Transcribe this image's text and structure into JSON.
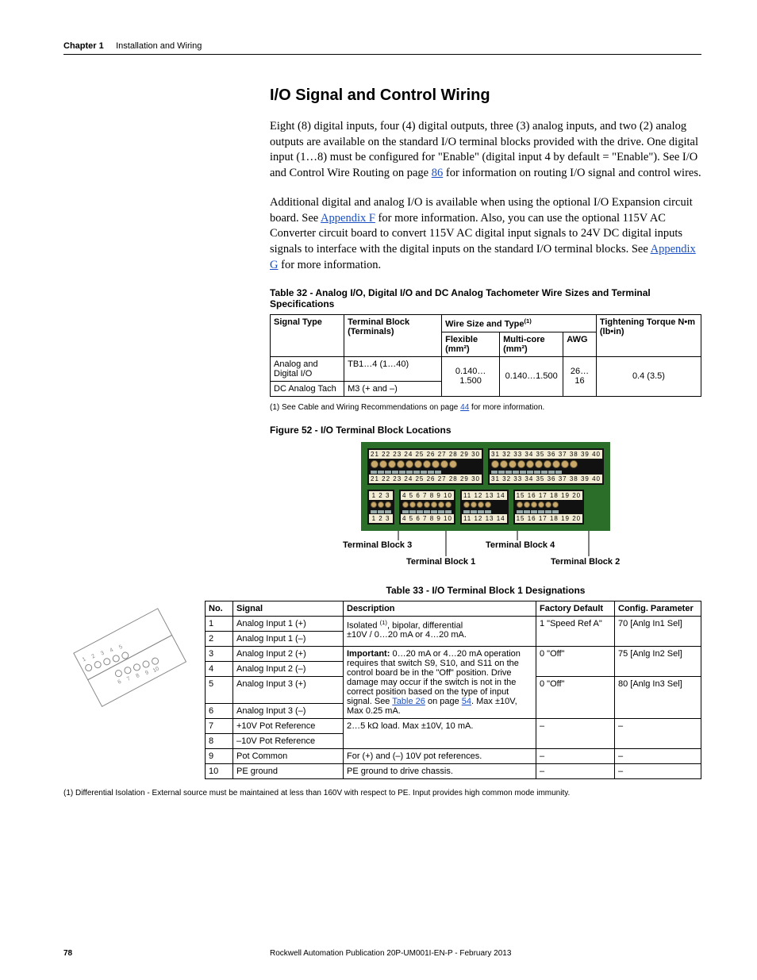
{
  "header": {
    "chapter": "Chapter 1",
    "title": "Installation and Wiring"
  },
  "section": {
    "heading": "I/O Signal and Control Wiring",
    "p1a": "Eight (8) digital inputs, four (4) digital outputs, three (3) analog inputs, and two (2) analog outputs are available on the standard I/O terminal blocks provided with the drive. One digital input (1…8) must be configured for \"Enable\" (digital input 4 by default = \"Enable\"). See I/O and Control Wire Routing on page ",
    "p1_link": "86",
    "p1b": " for information on routing I/O signal and control wires.",
    "p2a": "Additional digital and analog I/O is available when using the optional I/O Expansion circuit board. See ",
    "p2_link1": "Appendix F",
    "p2b": " for more information. Also, you can use the optional 115V AC Converter circuit board to convert 115V AC digital input signals to 24V DC digital inputs signals to interface with the digital inputs on the standard I/O terminal blocks. See ",
    "p2_link2": "Appendix G",
    "p2c": " for more information."
  },
  "table32": {
    "caption": "Table 32 - Analog I/O, Digital I/O and DC Analog Tachometer Wire Sizes and Terminal Specifications",
    "h_signal": "Signal Type",
    "h_tb": "Terminal Block (Terminals)",
    "h_wire": "Wire Size and Type",
    "h_wire_sup": "(1)",
    "h_flex": "Flexible (mm²)",
    "h_multi": "Multi-core (mm²)",
    "h_awg": "AWG",
    "h_tight": "Tightening Torque N•m (lb•in)",
    "r1_signal": "Analog and Digital I/O",
    "r1_tb": "TB1…4 (1…40)",
    "r2_signal": "DC Analog Tach",
    "r2_tb": "M3 (+ and –)",
    "v_flex": "0.140…1.500",
    "v_multi": "0.140…1.500",
    "v_awg": "26…16",
    "v_torque": "0.4 (3.5)",
    "footnote_a": "(1)   See Cable and Wiring Recommendations on page ",
    "footnote_link": "44",
    "footnote_b": " for more information."
  },
  "figure52": {
    "caption": "Figure 52 - I/O Terminal Block Locations",
    "top_nums_a": "21 22 23 24 25 26 27 28 29 30",
    "top_nums_b": "31 32 33 34 35 36 37 38 39 40",
    "bot_nums_a": "1  2  3",
    "bot_nums_b": "4  5  6  7  8  9  10",
    "bot_nums_c": "11 12 13 14",
    "bot_nums_d": "15 16 17 18 19 20",
    "lbl_tb3": "Terminal Block 3",
    "lbl_tb4": "Terminal Block 4",
    "lbl_tb1": "Terminal Block 1",
    "lbl_tb2": "Terminal Block 2"
  },
  "table33": {
    "caption": "Table 33 - I/O Terminal Block 1 Designations",
    "h_no": "No.",
    "h_signal": "Signal",
    "h_desc": "Description",
    "h_fd": "Factory Default",
    "h_cp": "Config. Parameter",
    "rows": {
      "r1_no": "1",
      "r1_sig": "Analog Input 1 (+)",
      "r2_no": "2",
      "r2_sig": "Analog Input 1 (–)",
      "r3_no": "3",
      "r3_sig": "Analog Input 2 (+)",
      "r4_no": "4",
      "r4_sig": "Analog Input 2 (–)",
      "r5_no": "5",
      "r5_sig": "Analog Input 3 (+)",
      "r6_no": "6",
      "r6_sig": "Analog Input 3 (–)",
      "r7_no": "7",
      "r7_sig": "+10V Pot Reference",
      "r8_no": "8",
      "r8_sig": "–10V Pot Reference",
      "r9_no": "9",
      "r9_sig": "Pot Common",
      "r10_no": "10",
      "r10_sig": "PE ground"
    },
    "desc12a": "Isolated ",
    "desc12sup": "(1)",
    "desc12b": ", bipolar, differential",
    "desc12c": "±10V / 0…20 mA or 4…20 mA.",
    "desc36a": "Important:",
    "desc36b": " 0…20 mA or 4…20 mA operation requires that switch S9, S10, and S11 on the control board be in the \"Off\" position. Drive damage may occur if the switch is not in the correct position based on the type of input signal. See ",
    "desc36link": "Table 26",
    "desc36c": " on page ",
    "desc36page": "54",
    "desc36d": ". Max ±10V, Max 0.25 mA.",
    "desc78": "2…5 kΩ load. Max ±10V, 10 mA.",
    "desc9": "For (+) and (–) 10V pot references.",
    "desc10": "PE ground to drive chassis.",
    "fd1": "1 \"Speed Ref A\"",
    "fd3": "0 \"Off\"",
    "fd5": "0 \"Off\"",
    "dash": "–",
    "cp1": "70 [Anlg In1 Sel]",
    "cp3": "75 [Anlg In2 Sel]",
    "cp5": "80 [Anlg In3 Sel]",
    "footnote": "(1)    Differential Isolation - External source must be maintained at less than 160V with respect to PE. Input provides high common mode immunity."
  },
  "footer": {
    "page": "78",
    "pub": "Rockwell Automation Publication 20P-UM001I-EN-P - February 2013"
  }
}
